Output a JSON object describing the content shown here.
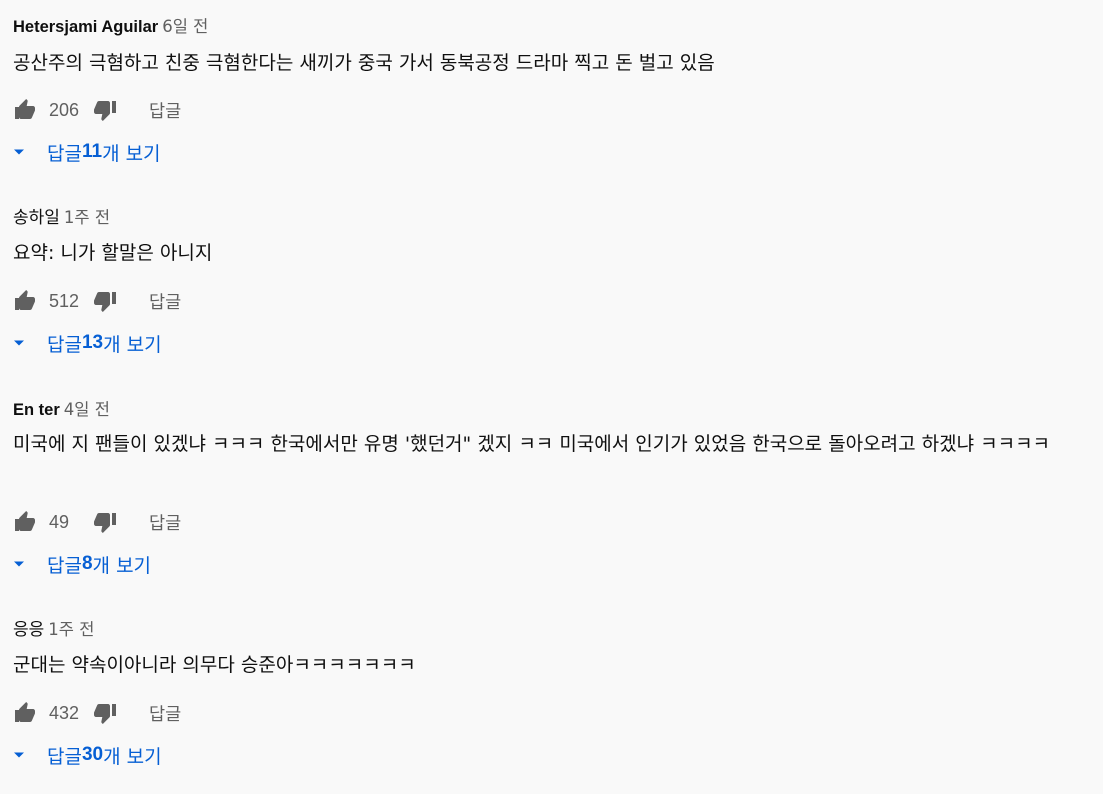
{
  "theme": {
    "link_color": "#065fd4",
    "meta_color": "#606060",
    "text_color": "#0f0f0f",
    "background": "#f9f9f9"
  },
  "icons": {
    "like": "thumbs-up-icon",
    "dislike": "thumbs-down-icon",
    "expand": "caret-down-icon"
  },
  "comments": [
    {
      "author": "Hetersjami Aguilar",
      "time": "6일 전",
      "text": "공산주의 극혐하고 친중 극혐한다는 새끼가 중국 가서 동북공정 드라마 찍고 돈 벌고 있음",
      "likes": "206",
      "reply_label": "답글",
      "replies_prefix": "답글 ",
      "replies_count": "11",
      "replies_suffix": "개 보기"
    },
    {
      "author": "송하일",
      "time": "1주 전",
      "text": "요약: 니가 할말은 아니지",
      "likes": "512",
      "reply_label": "답글",
      "replies_prefix": "답글 ",
      "replies_count": "13",
      "replies_suffix": "개 보기"
    },
    {
      "author": "En ter",
      "time": "4일 전",
      "text": "미국에 지 팬들이 있겠냐 ㅋㅋㅋ 한국에서만 유명 '했던거\" 겠지 ㅋㅋ 미국에서 인기가 있었음 한국으로 돌아오려고 하겠냐 ㅋㅋㅋㅋ",
      "likes": "49",
      "reply_label": "답글",
      "replies_prefix": "답글 ",
      "replies_count": "8",
      "replies_suffix": "개 보기"
    },
    {
      "author": "응응",
      "time": "1주 전",
      "text": "군대는 약속이아니라 의무다 승준아ㅋㅋㅋㅋㅋㅋㅋ",
      "likes": "432",
      "reply_label": "답글",
      "replies_prefix": "답글 ",
      "replies_count": "30",
      "replies_suffix": "개 보기"
    }
  ]
}
